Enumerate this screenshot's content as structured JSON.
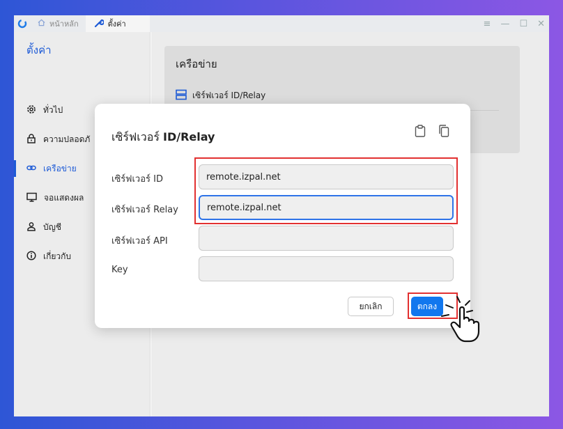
{
  "titlebar": {
    "tabs": [
      {
        "label": "หน้าหลัก",
        "icon": "home-icon"
      },
      {
        "label": "ตั้งค่า",
        "icon": "wrench-icon"
      }
    ],
    "controls": [
      "menu-icon",
      "minimize-icon",
      "maximize-icon",
      "close-icon"
    ]
  },
  "sidebar": {
    "title": "ตั้งค่า",
    "items": [
      {
        "label": "ทั่วไป",
        "icon": "gear-icon"
      },
      {
        "label": "ความปลอดภั",
        "icon": "lock-icon"
      },
      {
        "label": "เครือข่าย",
        "icon": "link-icon",
        "active": true
      },
      {
        "label": "จอแสดงผล",
        "icon": "monitor-icon"
      },
      {
        "label": "บัญชี",
        "icon": "user-icon"
      },
      {
        "label": "เกี่ยวกับ",
        "icon": "info-icon"
      }
    ]
  },
  "main": {
    "card_title": "เครือข่าย",
    "card_row_label": "เซิร์ฟเวอร์ ID/Relay"
  },
  "dialog": {
    "title_th": "เซิร์ฟเวอร์ ",
    "title_en": "ID/Relay",
    "fields": [
      {
        "label": "เซิร์ฟเวอร์ ID",
        "value": "remote.izpal.net"
      },
      {
        "label": "เซิร์ฟเวอร์ Relay",
        "value": "remote.izpal.net"
      },
      {
        "label": "เซิร์ฟเวอร์ API",
        "value": ""
      },
      {
        "label": "Key",
        "value": ""
      }
    ],
    "cancel_label": "ยกเลิก",
    "ok_label": "ตกลง"
  },
  "colors": {
    "accent": "#1e5bd6",
    "ok_button": "#1177ee",
    "highlight": "#e23030"
  }
}
